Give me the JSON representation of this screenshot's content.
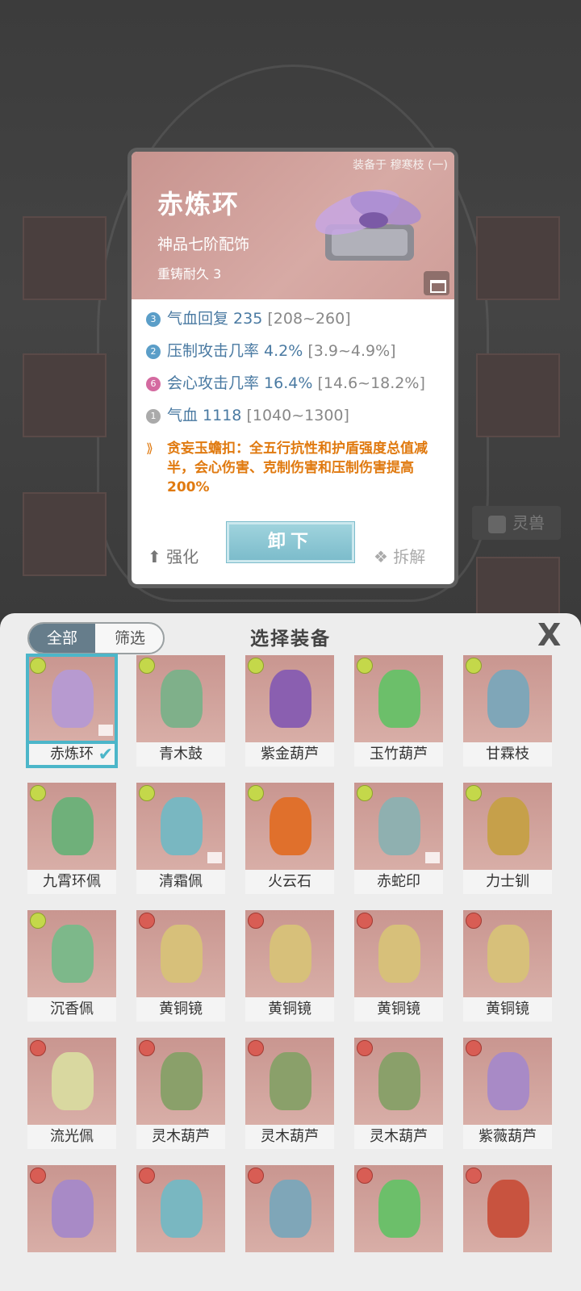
{
  "card": {
    "equipped_on": "装备于 穆寒枝 (一)",
    "name": "赤炼环",
    "grade": "神品七阶配饰",
    "reforge": "重铸耐久 3",
    "stats": [
      {
        "badge": "3",
        "label": "气血回复 235",
        "range": "[208~260]",
        "color": "#5b9ec8"
      },
      {
        "badge": "2",
        "label": "压制攻击几率 4.2%",
        "range": "[3.9~4.9%]",
        "color": "#5b9ec8"
      },
      {
        "badge": "6",
        "label": "会心攻击几率 16.4%",
        "range": "[14.6~18.2%]",
        "color": "#d46aa0"
      },
      {
        "badge": "1",
        "label": "气血 1118",
        "range": "[1040~1300]",
        "color": "#aaaaaa"
      }
    ],
    "effect": "贪妄玉蟾扣：全五行抗性和护盾强度总值减半，会心伤害、克制伤害和压制伤害提高200%",
    "strengthen": "强化",
    "unequip": "卸下",
    "dismantle": "拆解"
  },
  "background": {
    "tab_label": "灵兽"
  },
  "panel": {
    "tab_all": "全部",
    "tab_filter": "筛选",
    "title": "选择装备",
    "close": "X"
  },
  "items": [
    {
      "name": "赤炼环",
      "color": "#b79ad0"
    },
    {
      "name": "青木鼓",
      "color": "#7fb08a"
    },
    {
      "name": "紫金葫芦",
      "color": "#8a5fb0"
    },
    {
      "name": "玉竹葫芦",
      "color": "#6cbf6a"
    },
    {
      "name": "甘霖枝",
      "color": "#7fa6b8"
    },
    {
      "name": "九霄环佩",
      "color": "#6fb07a"
    },
    {
      "name": "清霜佩",
      "color": "#79b7c1"
    },
    {
      "name": "火云石",
      "color": "#e0702c"
    },
    {
      "name": "赤蛇印",
      "color": "#8fb0b0"
    },
    {
      "name": "力士钏",
      "color": "#c6a04a"
    },
    {
      "name": "沉香佩",
      "color": "#7db88a"
    },
    {
      "name": "黄铜镜",
      "color": "#d7c07a"
    },
    {
      "name": "黄铜镜",
      "color": "#d7c07a"
    },
    {
      "name": "黄铜镜",
      "color": "#d7c07a"
    },
    {
      "name": "黄铜镜",
      "color": "#d7c07a"
    },
    {
      "name": "流光佩",
      "color": "#d9d8a0"
    },
    {
      "name": "灵木葫芦",
      "color": "#8aa06a"
    },
    {
      "name": "灵木葫芦",
      "color": "#8aa06a"
    },
    {
      "name": "灵木葫芦",
      "color": "#8aa06a"
    },
    {
      "name": "紫薇葫芦",
      "color": "#a88ac6"
    },
    {
      "name": "",
      "color": "#a88ac6"
    },
    {
      "name": "",
      "color": "#79b7c1"
    },
    {
      "name": "",
      "color": "#7fa6b8"
    },
    {
      "name": "",
      "color": "#6cbf6a"
    },
    {
      "name": "",
      "color": "#c8533f"
    }
  ]
}
